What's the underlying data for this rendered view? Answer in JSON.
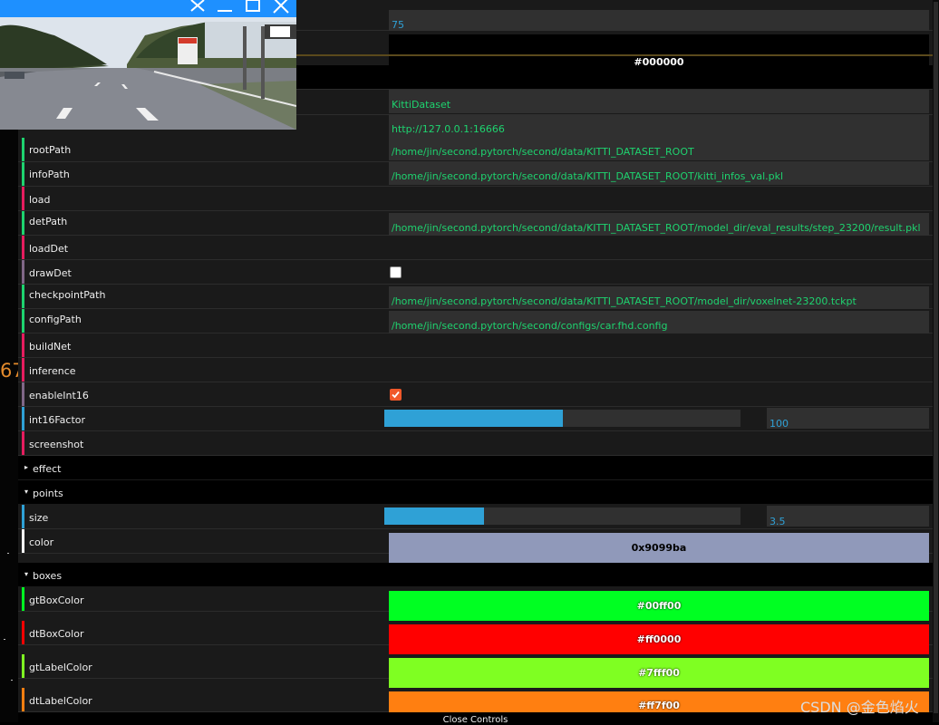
{
  "background": {
    "stat_text": "67"
  },
  "video": {
    "window": "camera-preview"
  },
  "gui": {
    "top_field_value": "75",
    "top_color": {
      "value": "#000000",
      "bg": "#000000",
      "fg": "#ffffff"
    },
    "dataset_field": "KittiDataset",
    "url_field": "http://127.0.0.1:16666",
    "rows": {
      "rootPath": {
        "label": "rootPath",
        "value": "/home/jin/second.pytorch/second/data/KITTI_DATASET_ROOT"
      },
      "infoPath": {
        "label": "infoPath",
        "value": "/home/jin/second.pytorch/second/data/KITTI_DATASET_ROOT/kitti_infos_val.pkl"
      },
      "load": {
        "label": "load"
      },
      "detPath": {
        "label": "detPath",
        "value": "/home/jin/second.pytorch/second/data/KITTI_DATASET_ROOT/model_dir/eval_results/step_23200/result.pkl"
      },
      "loadDet": {
        "label": "loadDet"
      },
      "drawDet": {
        "label": "drawDet",
        "checked": false
      },
      "checkpointPath": {
        "label": "checkpointPath",
        "value": "/home/jin/second.pytorch/second/data/KITTI_DATASET_ROOT/model_dir/voxelnet-23200.tckpt"
      },
      "configPath": {
        "label": "configPath",
        "value": "/home/jin/second.pytorch/second/configs/car.fhd.config"
      },
      "buildNet": {
        "label": "buildNet"
      },
      "inference": {
        "label": "inference"
      },
      "enableInt16": {
        "label": "enableInt16",
        "checked": true
      },
      "int16Factor": {
        "label": "int16Factor",
        "value": "100",
        "fraction": 0.5
      },
      "screenshot": {
        "label": "screenshot"
      }
    },
    "folders": {
      "effect": {
        "label": "effect",
        "open": false
      },
      "points": {
        "label": "points",
        "open": true
      },
      "boxes": {
        "label": "boxes",
        "open": true
      }
    },
    "points": {
      "size": {
        "label": "size",
        "value": "3.5",
        "fraction": 0.28
      },
      "color": {
        "label": "color",
        "value": "0x9099ba",
        "bg": "#9099ba",
        "fg": "#000000"
      }
    },
    "boxes": {
      "gtBoxColor": {
        "label": "gtBoxColor",
        "value": "#00ff00",
        "bg": "#00ff22"
      },
      "dtBoxColor": {
        "label": "dtBoxColor",
        "value": "#ff0000",
        "bg": "#ff0000"
      },
      "gtLabelColor": {
        "label": "gtLabelColor",
        "value": "#7fff00",
        "bg": "#7fff22"
      },
      "dtLabelColor": {
        "label": "dtLabelColor",
        "value": "#ff7f00",
        "bg": "#ff7f11"
      }
    },
    "close_controls": "Close Controls"
  },
  "watermark": "CSDN @金色焰火",
  "colors": {
    "string_bar": "#1ed36f",
    "function_bar": "#e61d5f",
    "boolean_bar": "#806787",
    "number_bar": "#2fa1d6",
    "color_bar_white": "#ffffff",
    "titlebar": "#1e90ff",
    "checkbox_on": "#f0582a"
  }
}
